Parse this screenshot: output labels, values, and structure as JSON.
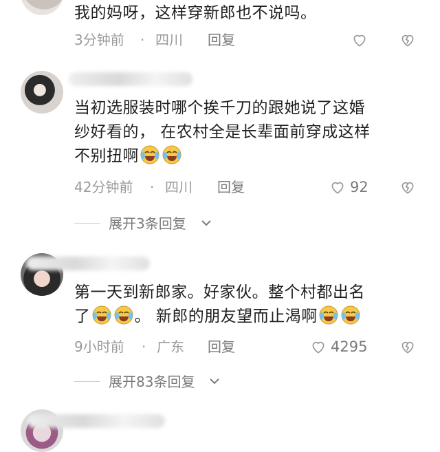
{
  "comments": [
    {
      "text": "我的妈呀，这样穿新郎也不说吗。",
      "time": "3分钟前",
      "location": "四川",
      "reply_label": "回复",
      "likes": ""
    },
    {
      "text_lines": [
        "当初选服装时哪个挨千刀的跟她说了这婚",
        "纱好看的， 在农村全是长辈面前穿成这样",
        "不别扭啊"
      ],
      "time": "42分钟前",
      "location": "四川",
      "reply_label": "回复",
      "likes": "92",
      "expand_label": "展开3条回复"
    },
    {
      "text_lines": [
        "第一天到新郎家。好家伙。整个村都出名",
        "了",
        "。 新郎的朋友望而止渴啊"
      ],
      "time": "9小时前",
      "location": "广东",
      "reply_label": "回复",
      "likes": "4295",
      "expand_label": "展开83条回复"
    }
  ],
  "separator": "·",
  "icons": {
    "like": "heart-outline-icon",
    "dislike": "broken-heart-icon",
    "emoji": "crying-laughing-emoji",
    "expand": "chevron-down-icon"
  }
}
